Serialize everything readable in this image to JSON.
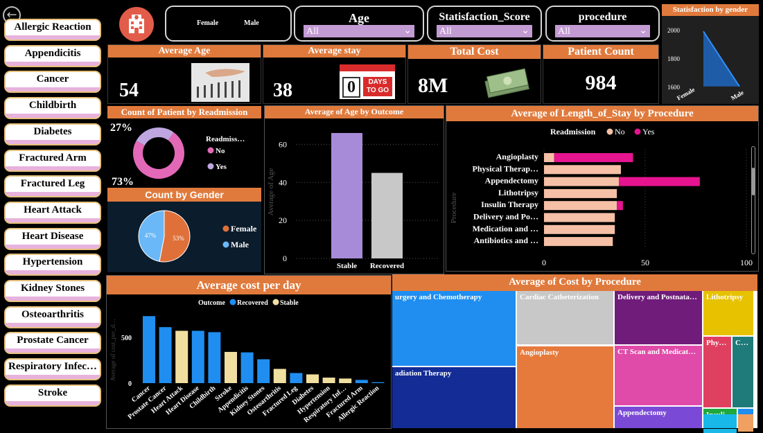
{
  "nav": {
    "back_icon": "back-arrow-icon"
  },
  "sidebar": {
    "items": [
      "Allergic Reaction",
      "Appendicitis",
      "Cancer",
      "Childbirth",
      "Diabetes",
      "Fractured Arm",
      "Fractured Leg",
      "Heart Attack",
      "Heart Disease",
      "Hypertension",
      "Kidney Stones",
      "Osteoarthritis",
      "Prostate Cancer",
      "Respiratory Infec…",
      "Stroke"
    ]
  },
  "header": {
    "logo_icon": "hospital-icon",
    "gender_female": "Female",
    "gender_male": "Male"
  },
  "filters": [
    {
      "label": "Age",
      "value": "All"
    },
    {
      "label": "Statisfaction_Score",
      "value": "All"
    },
    {
      "label": "procedure",
      "value": "All"
    }
  ],
  "kpis": {
    "avg_age": {
      "title": "Average Age",
      "value": "54"
    },
    "avg_stay": {
      "title": "Average stay",
      "value": "38",
      "calendar_day": "0",
      "calendar_text1": "DAYS",
      "calendar_text2": "TO GO"
    },
    "total_cost": {
      "title": "Total Cost",
      "value": "8M"
    },
    "patient_count": {
      "title": "Patient Count",
      "value": "984"
    }
  },
  "colors": {
    "orange": "#e07a3c",
    "pink": "#e369b8",
    "lavender": "#bfa6e0",
    "blue": "#1f8ef0",
    "cream": "#f1dfa0",
    "peach": "#f5c0a6",
    "magenta": "#e6148f",
    "purple_bar": "#a78bd9",
    "gray_bar": "#c8c8c8"
  },
  "chart_data": [
    {
      "id": "satisfaction_by_gender",
      "type": "area",
      "title": "Statisfaction by gender",
      "categories": [
        "Female",
        "Male"
      ],
      "values": [
        1990,
        1600
      ],
      "yticks": [
        "2000",
        "1800",
        "1600"
      ],
      "ylim": [
        1550,
        2050
      ]
    },
    {
      "id": "readmission",
      "type": "pie",
      "title": "Count of Patient by Readmission",
      "legend_title": "Readmiss…",
      "categories": [
        "No",
        "Yes"
      ],
      "values": [
        73,
        27
      ],
      "labels": [
        "73%",
        "27%"
      ]
    },
    {
      "id": "gender_count",
      "type": "pie",
      "title": "Count by Gender",
      "categories": [
        "Female",
        "Male"
      ],
      "values": [
        53,
        47
      ],
      "labels": [
        "53%",
        "47%"
      ]
    },
    {
      "id": "age_by_outcome",
      "type": "bar",
      "title": "Average of Age by Outcome",
      "ylabel": "Average of Age",
      "categories": [
        "Stable",
        "Recovered"
      ],
      "values": [
        66,
        45
      ],
      "ylim": [
        0,
        70
      ],
      "yticks": [
        0,
        20,
        40,
        60
      ]
    },
    {
      "id": "stay_by_procedure",
      "type": "bar",
      "title": "Average of Length_of_Stay by Procedure",
      "ylabel": "Procedure",
      "legend_title": "Readmission",
      "categories": [
        "Angioplasty",
        "Physical Therap…",
        "Appendectomy",
        "Lithotripsy",
        "Insulin Therapy",
        "Delivery and Po…",
        "Medication and …",
        "Antibiotics and …"
      ],
      "series": [
        {
          "name": "No",
          "values": [
            5,
            38,
            37,
            36,
            36,
            35,
            35,
            34
          ]
        },
        {
          "name": "Yes",
          "values": [
            39,
            0,
            40,
            0,
            3,
            0,
            0,
            0
          ]
        }
      ],
      "xlim": [
        0,
        100
      ],
      "xticks": [
        0,
        50,
        100
      ]
    },
    {
      "id": "cost_per_day",
      "type": "bar",
      "title": "Average cost per day",
      "ylabel": "Average of cost_per_d…",
      "legend_title": "Outcome",
      "series_names": [
        "Recovered",
        "Stable"
      ],
      "categories": [
        "Cancer",
        "Prostate Cancer",
        "Heart Attack",
        "Heart Disease",
        "Childbirth",
        "Stroke",
        "Appendicitis",
        "Kidney Stones",
        "Osteoarthritis",
        "Fractured Leg",
        "Diabetes",
        "Hypertension",
        "Respiratory Inf…",
        "Fractured Arm",
        "Allergic Reaction"
      ],
      "values": [
        730,
        610,
        570,
        570,
        555,
        340,
        335,
        260,
        155,
        110,
        95,
        60,
        50,
        35,
        10
      ],
      "outcome": [
        "Recovered",
        "Recovered",
        "Stable",
        "Recovered",
        "Recovered",
        "Stable",
        "Recovered",
        "Recovered",
        "Stable",
        "Recovered",
        "Stable",
        "Stable",
        "Stable",
        "Recovered",
        "Recovered"
      ],
      "ylim": [
        0,
        800
      ],
      "yticks": [
        0,
        500
      ]
    },
    {
      "id": "cost_by_procedure",
      "type": "heatmap",
      "title": "Average of Cost by Procedure",
      "labels": [
        "urgery and Chemotherapy",
        "Cardiac Catheterization",
        "Delivery and Postnata…",
        "Lithotripsy",
        "adiation Therapy",
        "Angioplasty",
        "CT Scan and Medicat…",
        "Phy…",
        "C…",
        "Appendectomy",
        "Insuli…"
      ]
    }
  ]
}
